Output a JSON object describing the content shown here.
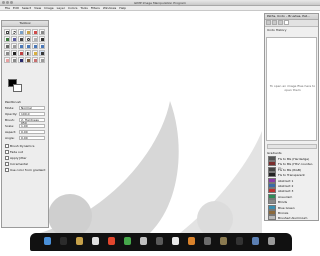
{
  "window": {
    "title": "GIMP Image Manipulation Program"
  },
  "menu": [
    "File",
    "Edit",
    "Select",
    "View",
    "Image",
    "Layer",
    "Colors",
    "Tools",
    "Filters",
    "Windows",
    "Help"
  ],
  "toolbox": {
    "title": "Toolbox",
    "section": "Paintbrush",
    "options": [
      {
        "label": "Mode:",
        "value": "Normal"
      },
      {
        "label": "Opacity:",
        "value": "100.0"
      },
      {
        "label": "Brush:",
        "value": "2. Hardness 050"
      },
      {
        "label": "Scale:",
        "value": "1.00"
      },
      {
        "label": "Aspect:",
        "value": "0.00"
      },
      {
        "label": "Angle:",
        "value": "0.00"
      }
    ],
    "checks": [
      "Brush Dynamics",
      "Fade out",
      "Apply Jitter",
      "Incremental",
      "Use color from gradient"
    ],
    "fg_color": "#000000",
    "bg_color": "#ffffff"
  },
  "dock": {
    "title": "Paths, Undo – Brushes, Pat...",
    "undo_header": "Undo History",
    "hint": "To open an image files here to open them"
  },
  "gradients": {
    "header": "Gradients",
    "items": [
      {
        "name": "FG to BG (Hardedge)",
        "color": "#555555"
      },
      {
        "name": "FG to BG (HSV counter-cl...",
        "color": "#7a2d2d"
      },
      {
        "name": "FG to BG (RGB)",
        "color": "#444444"
      },
      {
        "name": "FG to Transparent",
        "color": "#222222"
      },
      {
        "name": "Abstract 1",
        "color": "#8a3aa8"
      },
      {
        "name": "Abstract 2",
        "color": "#3a6aa8"
      },
      {
        "name": "Abstract 3",
        "color": "#c03030"
      },
      {
        "name": "Aneurism",
        "color": "#2e8b57"
      },
      {
        "name": "Blinds",
        "color": "#888888"
      },
      {
        "name": "Blue Green",
        "color": "#3b8fb0"
      },
      {
        "name": "Bronze",
        "color": "#8c6a3c"
      },
      {
        "name": "Brushed Aluminium",
        "color": "#b9b9b9"
      }
    ]
  },
  "taskbar": {
    "icons": [
      {
        "name": "finder-icon",
        "color": "#4a90d9"
      },
      {
        "name": "terminal-icon",
        "color": "#2b2b2b"
      },
      {
        "name": "files-icon",
        "color": "#c6a14a"
      },
      {
        "name": "text-editor-icon",
        "color": "#e0e0e0"
      },
      {
        "name": "browser-icon",
        "color": "#e2462d"
      },
      {
        "name": "chrome-icon",
        "color": "#46a84b"
      },
      {
        "name": "music-icon",
        "color": "#c0c0c0"
      },
      {
        "name": "settings-icon",
        "color": "#5a5a5a"
      },
      {
        "name": "calendar-icon",
        "color": "#e8e8e8"
      },
      {
        "name": "photos-icon",
        "color": "#d9822b"
      },
      {
        "name": "system-icon",
        "color": "#6c6c6c"
      },
      {
        "name": "gimp-icon",
        "color": "#8a7a50"
      },
      {
        "name": "monitor-icon",
        "color": "#333333"
      },
      {
        "name": "downloads-icon",
        "color": "#5b7fb3"
      },
      {
        "name": "trash-icon",
        "color": "#9a9a9a"
      }
    ]
  }
}
